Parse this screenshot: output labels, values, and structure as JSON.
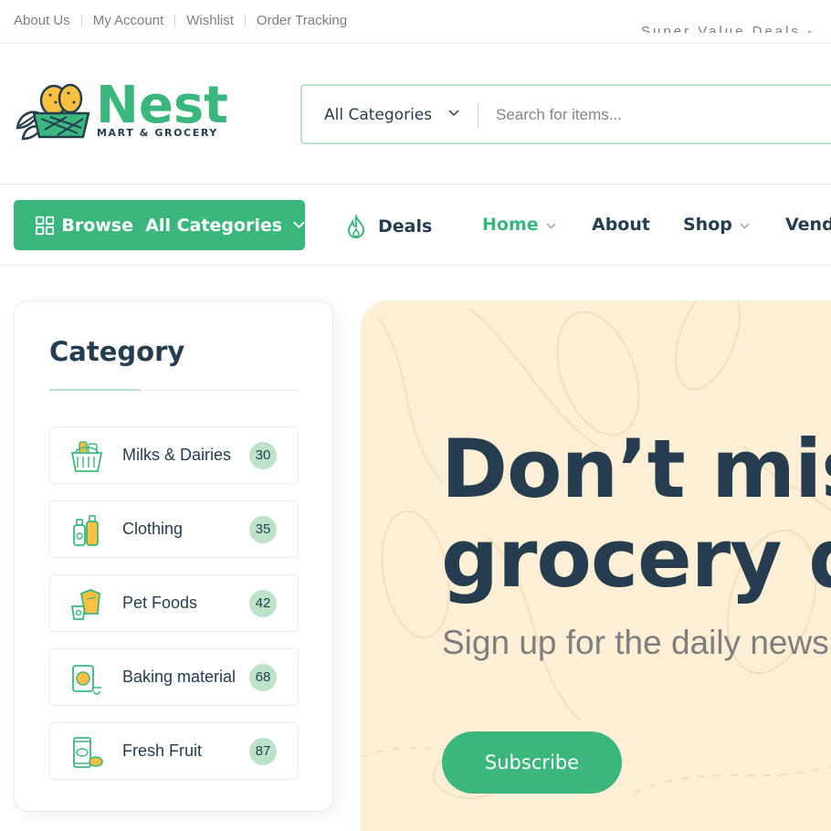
{
  "topbar": {
    "links": [
      "About Us",
      "My Account",
      "Wishlist",
      "Order Tracking"
    ],
    "promo": "Super Value Deals - Save more with coupons"
  },
  "header": {
    "brand": "Nest",
    "tagline": "MART & GROCERY",
    "search": {
      "category": "All Categories",
      "placeholder": "Search for items..."
    }
  },
  "nav": {
    "browse_label": "Browse  All Categories",
    "items": [
      {
        "label": "Deals"
      },
      {
        "label": "Home"
      },
      {
        "label": "About"
      },
      {
        "label": "Shop"
      },
      {
        "label": "Vendors"
      }
    ]
  },
  "category_panel": {
    "title": "Category",
    "items": [
      {
        "name": "Milks & Dairies",
        "count": "30",
        "icon": "milk-basket-icon"
      },
      {
        "name": "Clothing",
        "count": "35",
        "icon": "bottles-icon"
      },
      {
        "name": "Pet Foods",
        "count": "42",
        "icon": "pet-food-icon"
      },
      {
        "name": "Baking material",
        "count": "68",
        "icon": "baking-jar-icon"
      },
      {
        "name": "Fresh Fruit",
        "count": "87",
        "icon": "fruit-pack-icon"
      }
    ]
  },
  "hero": {
    "headline_line1": "Don’t miss amazing",
    "headline_line2": "grocery deals",
    "subtitle": "Sign up for the daily newsletter",
    "button": "Subscribe"
  },
  "colors": {
    "brand_green": "#3bb77e",
    "light_green": "#bce3c9",
    "heading": "#253d4e",
    "muted": "#7e7e7e",
    "hero_bg": "#fdefd5"
  }
}
